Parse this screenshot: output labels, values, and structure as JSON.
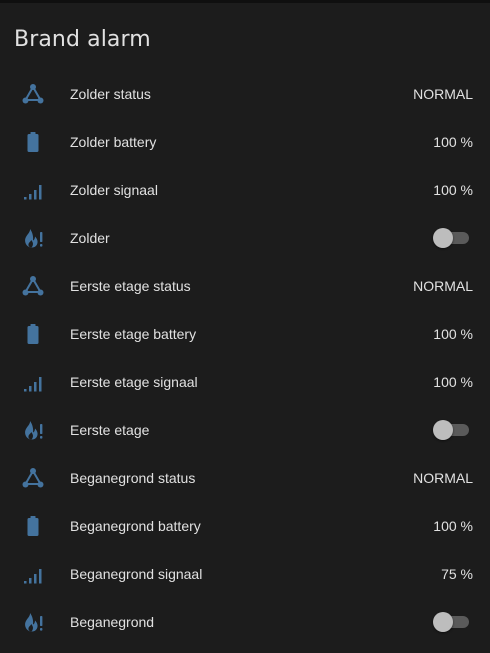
{
  "card": {
    "title": "Brand alarm"
  },
  "colors": {
    "icon": "#44739e",
    "background": "#1c1c1c",
    "text": "#e1e1e1"
  },
  "rows": [
    {
      "icon": "network-status-icon",
      "label": "Zolder status",
      "value": "NORMAL"
    },
    {
      "icon": "battery-icon",
      "label": "Zolder battery",
      "value": "100 %"
    },
    {
      "icon": "signal-icon",
      "label": "Zolder signaal",
      "value": "100 %"
    },
    {
      "icon": "fire-alert-icon",
      "label": "Zolder",
      "toggle": false
    },
    {
      "icon": "network-status-icon",
      "label": "Eerste etage status",
      "value": "NORMAL"
    },
    {
      "icon": "battery-icon",
      "label": "Eerste etage battery",
      "value": "100 %"
    },
    {
      "icon": "signal-icon",
      "label": "Eerste etage signaal",
      "value": "100 %"
    },
    {
      "icon": "fire-alert-icon",
      "label": "Eerste etage",
      "toggle": false
    },
    {
      "icon": "network-status-icon",
      "label": "Beganegrond status",
      "value": "NORMAL"
    },
    {
      "icon": "battery-icon",
      "label": "Beganegrond battery",
      "value": "100 %"
    },
    {
      "icon": "signal-icon",
      "label": "Beganegrond signaal",
      "value": "75 %"
    },
    {
      "icon": "fire-alert-icon",
      "label": "Beganegrond",
      "toggle": false
    }
  ]
}
